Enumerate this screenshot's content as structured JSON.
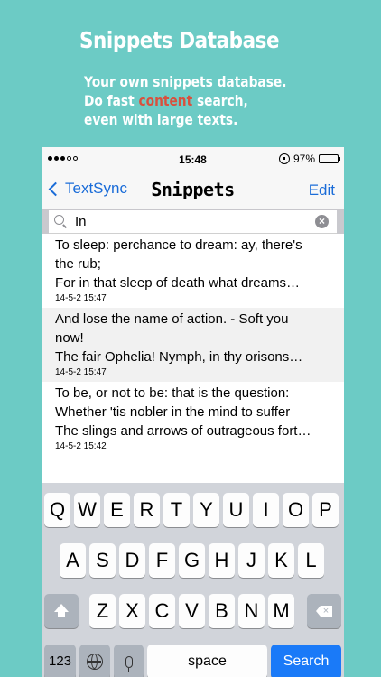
{
  "promo": {
    "title": "Snippets Database",
    "sub_line1": "Your own snippets database.",
    "sub_line2_pre": "Do fast ",
    "sub_line2_hl": "content",
    "sub_line2_post": " search,",
    "sub_line3": "even with large texts."
  },
  "status": {
    "time": "15:48",
    "battery": "97%",
    "battery_level": 0.97
  },
  "nav": {
    "back_label": "TextSync",
    "title": "Snippets",
    "edit_label": "Edit"
  },
  "search": {
    "value": "In",
    "clear": "×"
  },
  "rows": [
    {
      "line1": "To sleep: perchance to dream: ay, there's",
      "line2": "the rub;",
      "line3": "For in that sleep of death what dreams…",
      "date": "14-5-2 15:47"
    },
    {
      "line1": "And lose the name of action. - Soft you",
      "line2": "now!",
      "line3": "The fair Ophelia! Nymph, in thy orisons…",
      "date": "14-5-2 15:47"
    },
    {
      "line1": "To be, or not to be: that is the question:",
      "line2": "Whether 'tis nobler in the mind to suffer",
      "line3": "The slings and arrows of outrageous fort…",
      "date": "14-5-2 15:42"
    }
  ],
  "keyboard": {
    "row1": [
      "Q",
      "W",
      "E",
      "R",
      "T",
      "Y",
      "U",
      "I",
      "O",
      "P"
    ],
    "row2": [
      "A",
      "S",
      "D",
      "F",
      "G",
      "H",
      "J",
      "K",
      "L"
    ],
    "row3": [
      "Z",
      "X",
      "C",
      "V",
      "B",
      "N",
      "M"
    ],
    "numbers_label": "123",
    "space_label": "space",
    "search_label": "Search",
    "delete_glyph": "×"
  },
  "colors": {
    "background": "#6ccbc5",
    "accent": "#1a6cd8",
    "highlight": "#d9503d",
    "search_key": "#1a7af8"
  }
}
